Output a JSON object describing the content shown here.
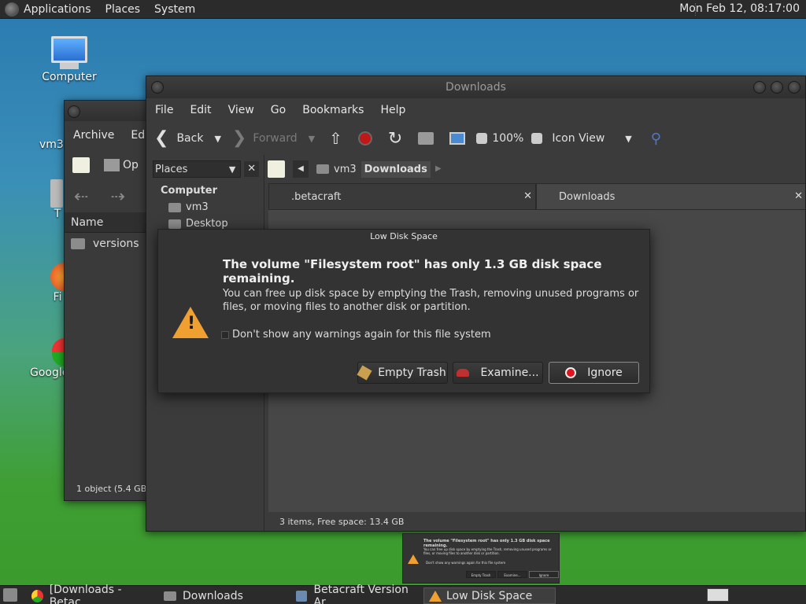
{
  "top_panel": {
    "menus": [
      "Applications",
      "Places",
      "System"
    ],
    "clock": "Mon Feb 12, 08:17:00"
  },
  "desktop_icons": [
    {
      "label": "Computer"
    },
    {
      "label": "vm3'"
    },
    {
      "label": "T"
    },
    {
      "label": "Fi"
    },
    {
      "label": "Google"
    }
  ],
  "back_window": {
    "menus": [
      "Archive",
      "Edit"
    ],
    "toolbar_open_label": "Op",
    "column_header": "Name",
    "rows": [
      "versions"
    ],
    "status": "1 object (5.4 GB)"
  },
  "downloads_window": {
    "title": "Downloads",
    "menus": [
      "File",
      "Edit",
      "View",
      "Go",
      "Bookmarks",
      "Help"
    ],
    "toolbar": {
      "back": "Back",
      "forward": "Forward",
      "zoom": "100%",
      "view_mode": "Icon View"
    },
    "places_label": "Places",
    "sidebar": {
      "heading": "Computer",
      "items": [
        "vm3",
        "Desktop"
      ]
    },
    "path": [
      "vm3",
      "Downloads"
    ],
    "tabs": [
      ".betacraft",
      "Downloads"
    ],
    "status": "3 items, Free space: 13.4 GB"
  },
  "dialog": {
    "title": "Low Disk Space",
    "heading": "The volume \"Filesystem root\" has only 1.3 GB disk space remaining.",
    "body": "You can free up disk space by emptying the Trash, removing unused programs or files, or moving files to another disk or partition.",
    "checkbox_label": "Don't show any warnings again for this file system",
    "buttons": {
      "empty_trash": "Empty Trash",
      "examine": "Examine...",
      "ignore": "Ignore"
    },
    "accent_color": "#f0a030",
    "ignore_color": "#e0141e"
  },
  "taskbar": {
    "tasks": [
      "[Downloads - Betac...",
      "Downloads",
      "Betacraft Version Ar...",
      "Low Disk Space"
    ],
    "preview": {
      "heading": "The volume \"Filesystem root\" has only 1.3 GB disk space remaining.",
      "body": "You can free up disk space by emptying the Trash, removing unused programs or files, or moving files to another disk or partition.",
      "checkbox_label": "Don't show any warnings again for this file system",
      "buttons": [
        "Empty Trash",
        "Examine...",
        "Ignore"
      ]
    }
  }
}
